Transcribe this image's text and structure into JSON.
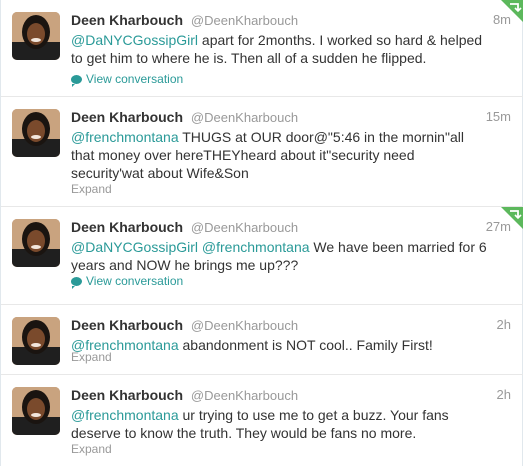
{
  "tweets": [
    {
      "fullname": "Deen Kharbouch",
      "username": "@DeenKharbouch",
      "time": "8m",
      "mention1": "@DaNYCGossipGirl",
      "text": " apart for 2months. I worked so hard & helped to get him to where he is. Then all of a sudden he flipped.",
      "action": "View conversation"
    },
    {
      "fullname": "Deen Kharbouch",
      "username": "@DeenKharbouch",
      "time": "15m",
      "mention1": "@frenchmontana",
      "text": " THUGS at OUR door@\"5:46 in the mornin\"all that money over hereTHEYheard about it\"security need security'wat about Wife&Son",
      "action": "Expand"
    },
    {
      "fullname": "Deen Kharbouch",
      "username": "@DeenKharbouch",
      "time": "27m",
      "mention1": "@DaNYCGossipGirl",
      "mention2": "@frenchmontana",
      "text": " We have been married for 6 years and NOW he brings me up???",
      "action": "View conversation"
    },
    {
      "fullname": "Deen Kharbouch",
      "username": "@DeenKharbouch",
      "time": "2h",
      "mention1": "@frenchmontana",
      "text": " abandonment is NOT cool.. Family First!",
      "action": "Expand"
    },
    {
      "fullname": "Deen Kharbouch",
      "username": "@DeenKharbouch",
      "time": "2h",
      "mention1": "@frenchmontana",
      "text": " ur trying to use me to get a buzz. Your fans deserve to know the truth. They would be fans no more.",
      "action": "Expand"
    }
  ],
  "colors": {
    "link": "#2a9a98",
    "muted": "#999999",
    "text": "#333333",
    "retweet_corner": "#5cb85c"
  },
  "icons": {
    "conversation": "speech-bubble-icon",
    "retweeted": "retweet-corner-icon"
  }
}
